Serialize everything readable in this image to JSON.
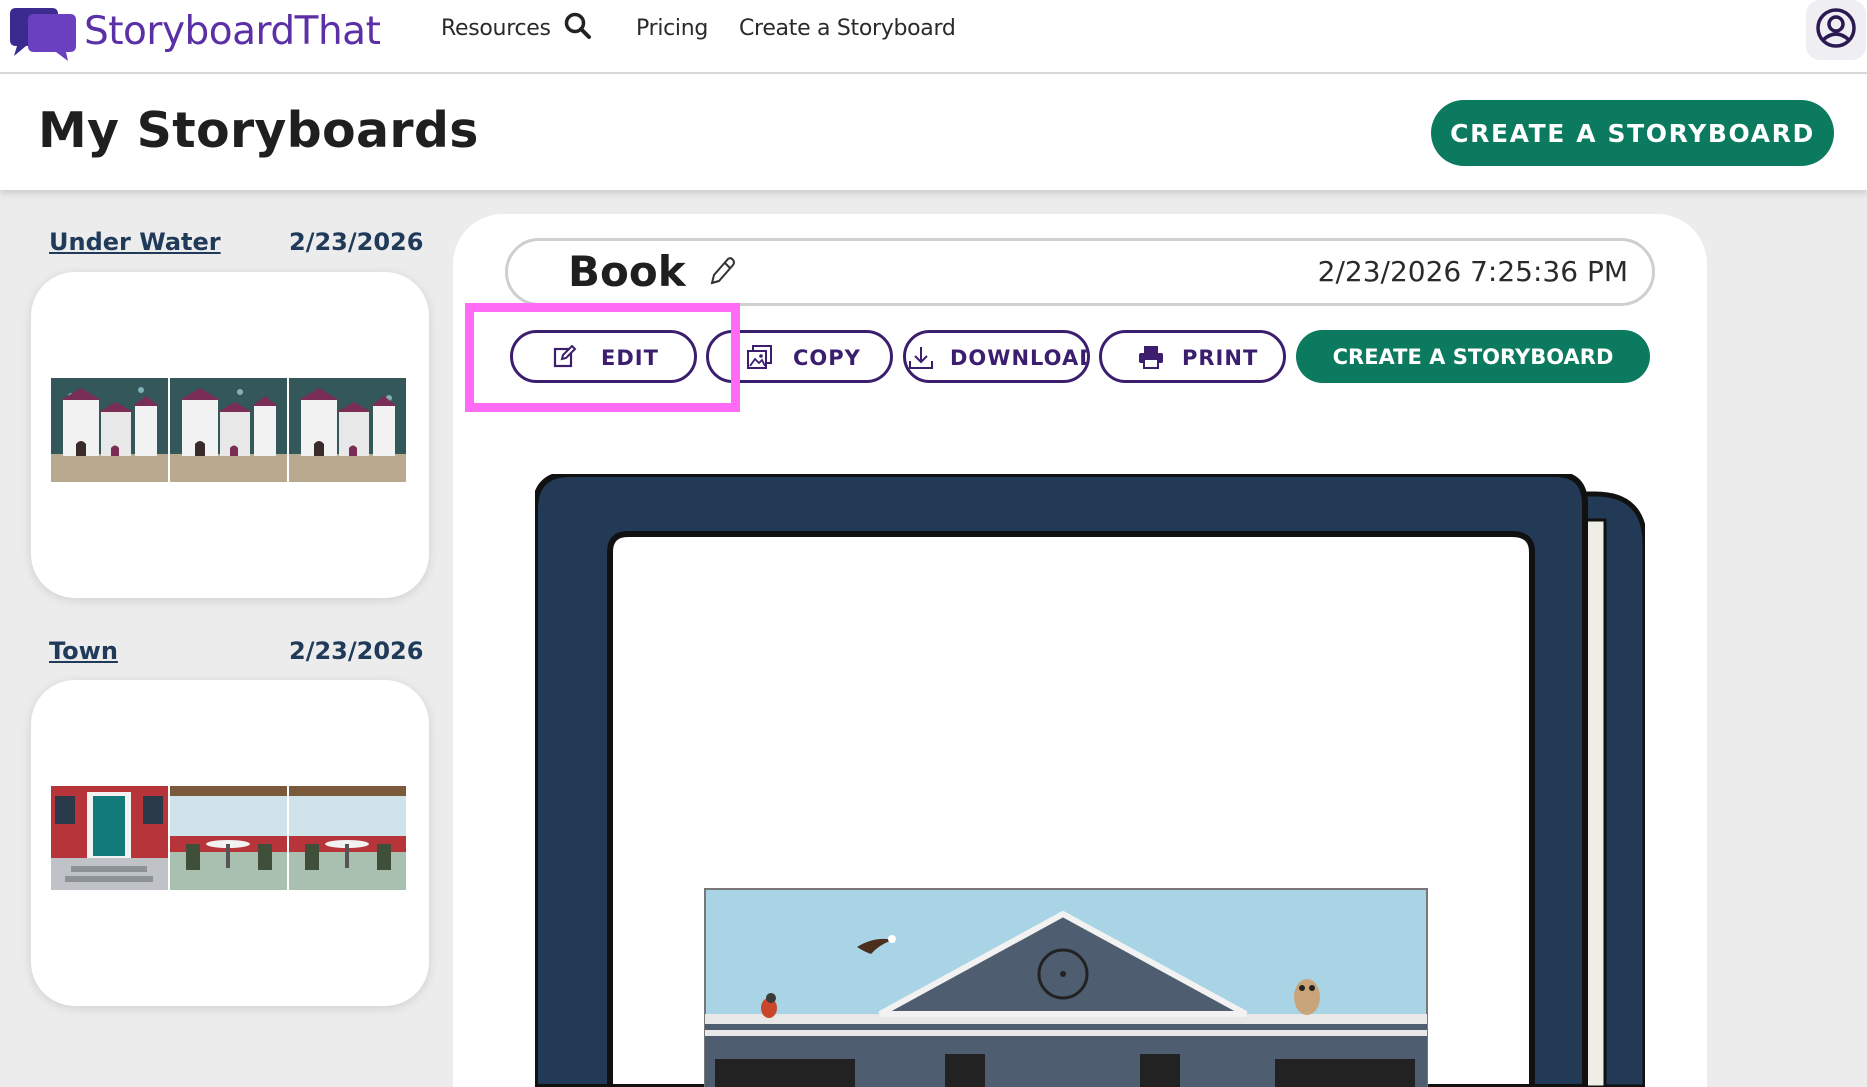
{
  "nav": {
    "logo_text": "StoryboardThat",
    "links": [
      "Resources",
      "Pricing",
      "Create a Storyboard"
    ]
  },
  "header": {
    "title": "My Storyboards",
    "cta": "CREATE A STORYBOARD"
  },
  "sidebar": {
    "items": [
      {
        "title": "Under Water",
        "date": "2/23/2026"
      },
      {
        "title": "Town",
        "date": "2/23/2026"
      }
    ]
  },
  "storyboard": {
    "name": "Book",
    "timestamp": "2/23/2026 7:25:36 PM",
    "actions": {
      "edit": "EDIT",
      "copy": "COPY",
      "download": "DOWNLOAD",
      "print": "PRINT",
      "create": "CREATE A STORYBOARD"
    }
  },
  "colors": {
    "brand_purple": "#5b2fa6",
    "button_outline": "#3b1f6e",
    "green_cta": "#0c7a5e",
    "highlight": "#ff6bf5",
    "book_cover": "#233a56"
  }
}
